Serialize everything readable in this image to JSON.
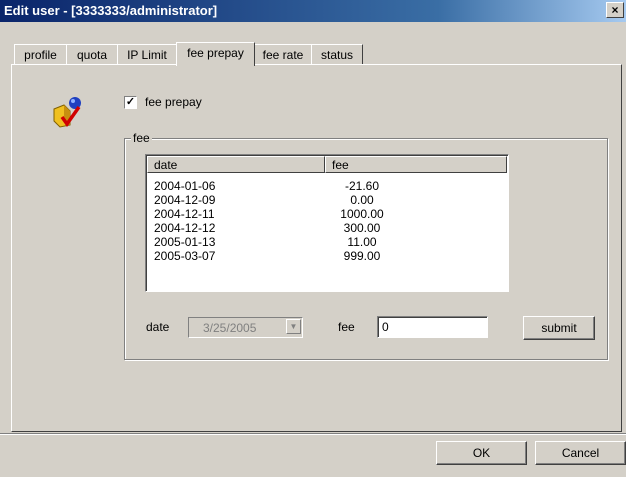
{
  "window": {
    "title": "Edit user - [3333333/administrator]",
    "close_glyph": "×"
  },
  "tabs": [
    {
      "label": "profile"
    },
    {
      "label": "quota"
    },
    {
      "label": "IP Limit"
    },
    {
      "label": "fee prepay",
      "active": true
    },
    {
      "label": "fee rate"
    },
    {
      "label": "status"
    }
  ],
  "prepay": {
    "checkbox_label": "fee prepay",
    "checked": true,
    "icon": "user-edit-icon"
  },
  "fee_group": {
    "legend": "fee",
    "columns": {
      "date": "date",
      "fee": "fee"
    },
    "rows": [
      {
        "date": "2004-01-06",
        "fee": "-21.60"
      },
      {
        "date": "2004-12-09",
        "fee": "0.00"
      },
      {
        "date": "2004-12-11",
        "fee": "1000.00"
      },
      {
        "date": "2004-12-12",
        "fee": "300.00"
      },
      {
        "date": "2005-01-13",
        "fee": "11.00"
      },
      {
        "date": "2005-03-07",
        "fee": "999.00"
      }
    ],
    "date_label": "date",
    "date_value": "3/25/2005",
    "fee_label": "fee",
    "fee_value": "0",
    "submit_label": "submit"
  },
  "footer": {
    "ok_label": "OK",
    "cancel_label": "Cancel"
  }
}
